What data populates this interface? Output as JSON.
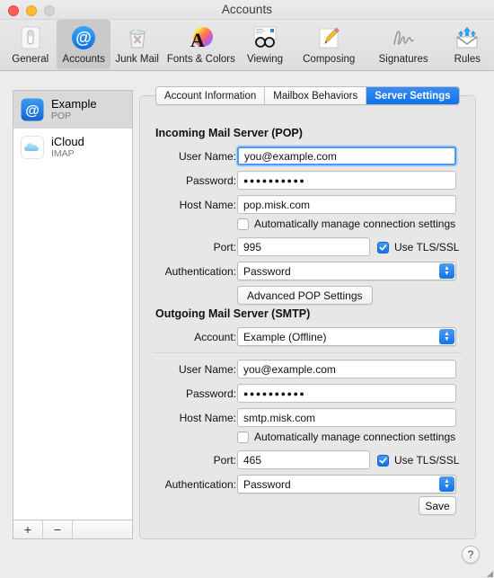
{
  "window": {
    "title": "Accounts",
    "traffic_lights": [
      "close-button",
      "minimize-button",
      "zoom-button"
    ]
  },
  "toolbar": {
    "items": [
      {
        "label": "General",
        "icon": "general-switch-icon",
        "selected": false
      },
      {
        "label": "Accounts",
        "icon": "accounts-at-sign-icon",
        "selected": true
      },
      {
        "label": "Junk Mail",
        "icon": "junk-mail-trash-icon",
        "selected": false
      },
      {
        "label": "Fonts & Colors",
        "icon": "fonts-colors-icon",
        "selected": false
      },
      {
        "label": "Viewing",
        "icon": "viewing-glasses-icon",
        "selected": false
      },
      {
        "label": "Composing",
        "icon": "composing-pencil-icon",
        "selected": false
      },
      {
        "label": "Signatures",
        "icon": "signatures-script-icon",
        "selected": false
      },
      {
        "label": "Rules",
        "icon": "rules-envelope-arrows-icon",
        "selected": false
      }
    ]
  },
  "sidebar": {
    "accounts": [
      {
        "name": "Example",
        "type": "POP",
        "icon": "mail-at-sign-icon",
        "selected": true
      },
      {
        "name": "iCloud",
        "type": "IMAP",
        "icon": "icloud-cloud-icon",
        "selected": false
      }
    ],
    "footer": {
      "add_label": "+",
      "remove_label": "−"
    }
  },
  "tabs": [
    {
      "label": "Account Information",
      "active": false
    },
    {
      "label": "Mailbox Behaviors",
      "active": false
    },
    {
      "label": "Server Settings",
      "active": true
    }
  ],
  "incoming": {
    "section_title": "Incoming Mail Server (POP)",
    "user_name": {
      "label": "User Name:",
      "value": "you@example.com",
      "focused": true
    },
    "password": {
      "label": "Password:",
      "value": "●●●●●●●●●●"
    },
    "host_name": {
      "label": "Host Name:",
      "value": "pop.misk.com"
    },
    "auto_manage": {
      "label": "Automatically manage connection settings",
      "checked": false
    },
    "port": {
      "label": "Port:",
      "value": "995"
    },
    "tls": {
      "label": "Use TLS/SSL",
      "checked": true
    },
    "authentication": {
      "label": "Authentication:",
      "value": "Password"
    },
    "advanced_button": "Advanced POP Settings"
  },
  "outgoing": {
    "section_title": "Outgoing Mail Server (SMTP)",
    "account": {
      "label": "Account:",
      "value": "Example (Offline)"
    },
    "user_name": {
      "label": "User Name:",
      "value": "you@example.com"
    },
    "password": {
      "label": "Password:",
      "value": "●●●●●●●●●●"
    },
    "host_name": {
      "label": "Host Name:",
      "value": "smtp.misk.com"
    },
    "auto_manage": {
      "label": "Automatically manage connection settings",
      "checked": false
    },
    "port": {
      "label": "Port:",
      "value": "465"
    },
    "tls": {
      "label": "Use TLS/SSL",
      "checked": true
    },
    "authentication": {
      "label": "Authentication:",
      "value": "Password"
    },
    "save_button": "Save"
  },
  "help": {
    "label": "?"
  },
  "colors": {
    "accent_blue": "#1073e8",
    "window_bg": "#ececec",
    "panel_bg": "#e7e7e7",
    "selected_row": "#d9d9d9"
  }
}
